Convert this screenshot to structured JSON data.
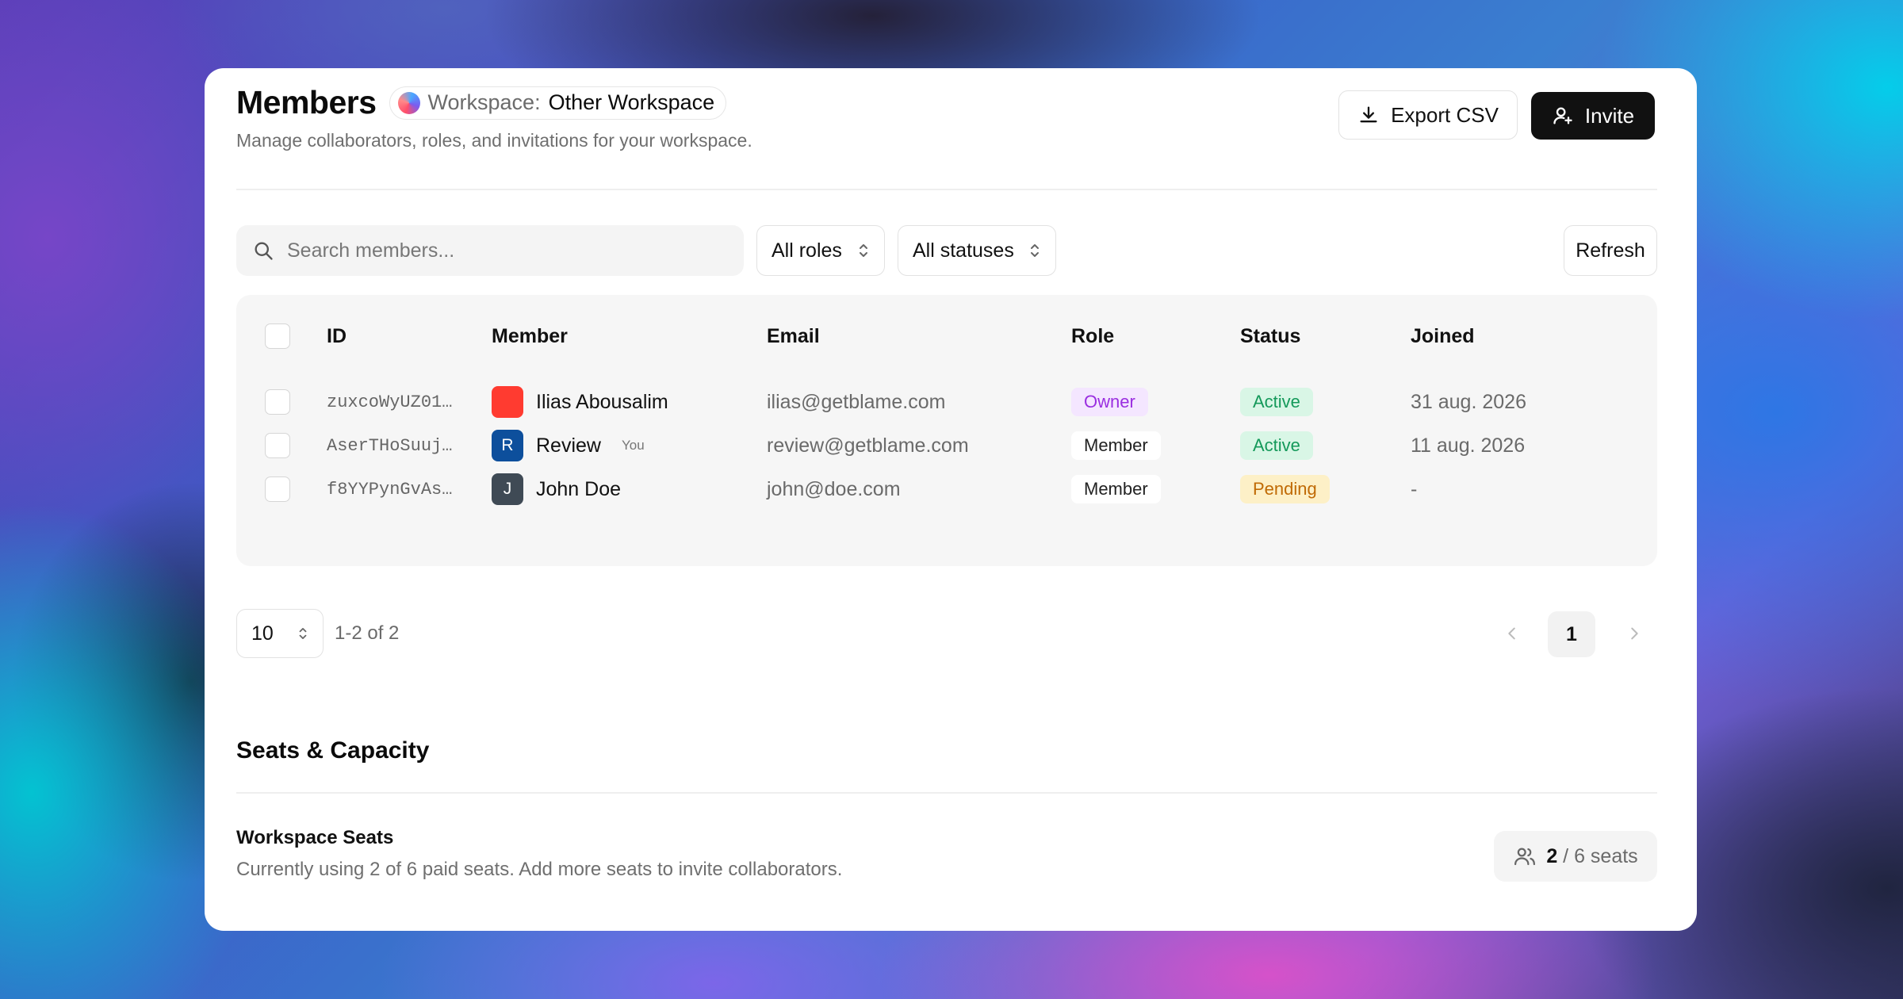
{
  "header": {
    "title": "Members",
    "workspace_label": "Workspace:",
    "workspace_name": "Other Workspace",
    "subtitle": "Manage collaborators, roles, and invitations for your workspace.",
    "export_label": "Export CSV",
    "invite_label": "Invite"
  },
  "filters": {
    "search_placeholder": "Search members...",
    "role_value": "All roles",
    "status_value": "All statuses",
    "refresh_label": "Refresh"
  },
  "table": {
    "columns": [
      "ID",
      "Member",
      "Email",
      "Role",
      "Status",
      "Joined"
    ],
    "rows": [
      {
        "id": "zuxcoWyUZ01…",
        "member": "Ilias Abousalim",
        "avatar_letter": "",
        "avatar_color": "#ff3b30",
        "you": "",
        "email": "ilias@getblame.com",
        "role": "Owner",
        "status": "Active",
        "joined": "31 aug. 2026"
      },
      {
        "id": "AserTHoSuuj…",
        "member": "Review",
        "avatar_letter": "R",
        "avatar_color": "#0d4f9c",
        "you": "You",
        "email": "review@getblame.com",
        "role": "Member",
        "status": "Active",
        "joined": "11 aug. 2026"
      },
      {
        "id": "f8YYPynGvAs…",
        "member": "John Doe",
        "avatar_letter": "J",
        "avatar_color": "#3f4a55",
        "you": "",
        "email": "john@doe.com",
        "role": "Member",
        "status": "Pending",
        "joined": "-"
      }
    ]
  },
  "pagination": {
    "page_size": "10",
    "range": "1-2 of 2",
    "current_page": "1"
  },
  "seats": {
    "section_title": "Seats & Capacity",
    "title": "Workspace Seats",
    "description": "Currently using 2 of 6 paid seats. Add more seats to invite collaborators.",
    "used": "2",
    "total": "/ 6 seats"
  },
  "colors": {
    "owner_bg": "#f4e6ff",
    "owner_text": "#9a2ee0",
    "active_bg": "#d9f6e6",
    "active_text": "#14995a",
    "pending_bg": "#fdf0c7",
    "pending_text": "#c06a05",
    "primary": "#111111"
  },
  "icons": [
    "workspace-dot-icon",
    "download-icon",
    "user-plus-icon",
    "search-icon",
    "chevron-updown-icon",
    "chevron-left-icon",
    "chevron-right-icon",
    "users-icon"
  ]
}
